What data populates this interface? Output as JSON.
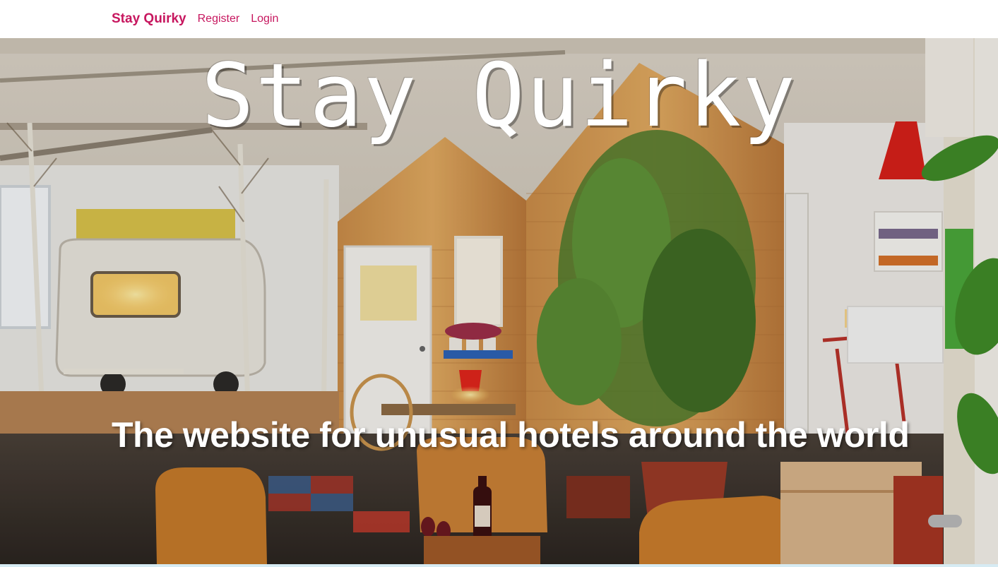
{
  "navbar": {
    "brand": "Stay Quirky",
    "links": [
      "Register",
      "Login"
    ]
  },
  "hero": {
    "title": "Stay Quirky",
    "subtitle": "The website for unusual hotels around the world"
  },
  "colors": {
    "brand": "#c7175f",
    "hero_text": "#ffffff"
  }
}
